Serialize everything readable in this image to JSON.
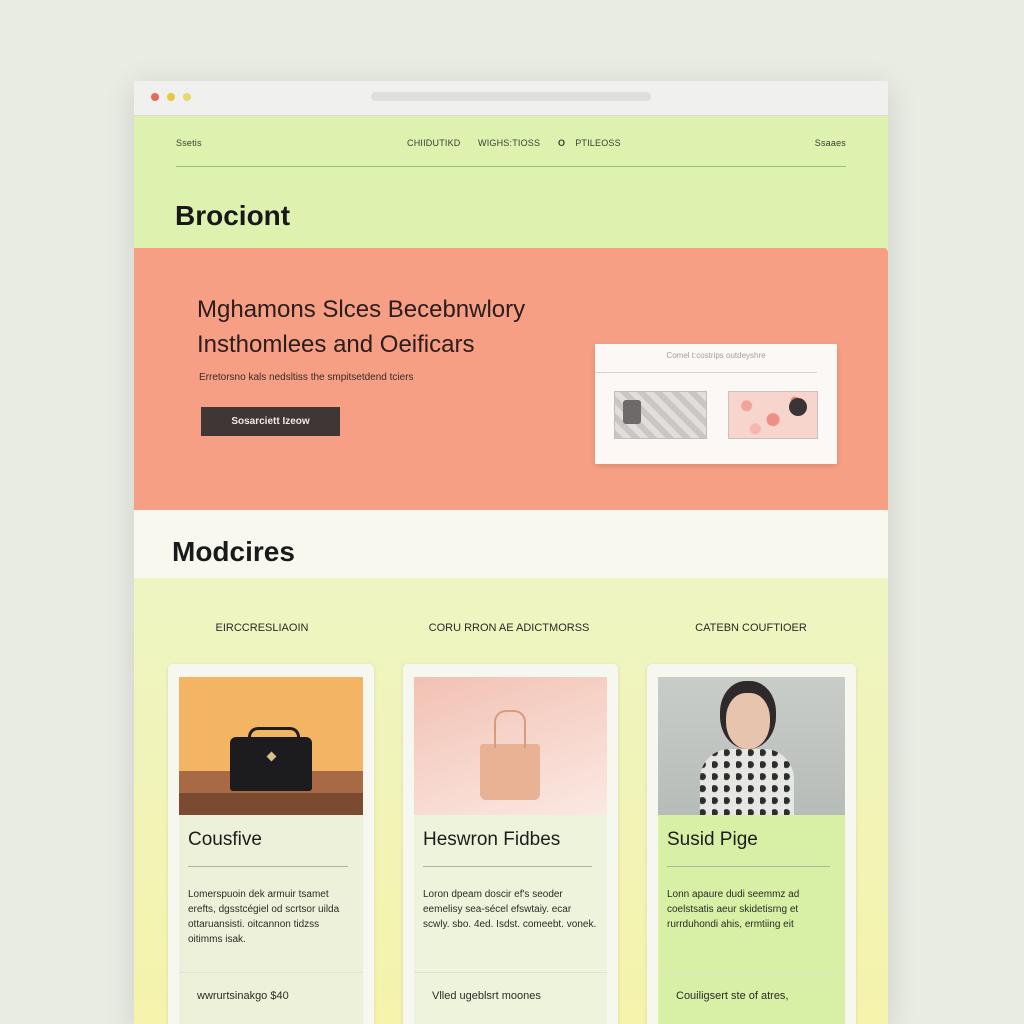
{
  "nav": {
    "left": "Ssetis",
    "items": [
      "CHIIDUTIKD",
      "WIGHS:TIOSS",
      "PTILEOSS"
    ],
    "item3_glyph": "O",
    "right": "Ssaaes"
  },
  "brand": "Brociont",
  "hero": {
    "headline_line1": "Mghamons Slces Becebnwlory",
    "headline_line2": "Insthomlees and Oeificars",
    "subtext": "Erretorsno kals nedsltiss the smpitsetdend tciers",
    "cta_label": "Sosarciett Izeow",
    "preview_title": "Comel t:costrips outdeyshre"
  },
  "modules": {
    "title": "Modcires",
    "columns": [
      "EIRCCRESLIAOIN",
      "CORU RRON AE ADICTMORSS",
      "CATEBN COUFTIOER"
    ],
    "cards": [
      {
        "title": "Cousfive",
        "body": "Lomerspuoin dek armuir tsamet erefts, dgsstcégiel od scrtsor uilda ottaruansisti. oitcannon tidzss oitimms isak.",
        "footer": "wwrurtsinakgo $40"
      },
      {
        "title": "Heswron Fidbes",
        "body": "Loron dpeam doscir ef's seoder eemelisy sea-sécel efswtaiy. ecar scwly. sbo. 4ed. Isdst. comeebt. vonek.",
        "footer": "Vlled ugeblsrt moones"
      },
      {
        "title": "Susid Pige",
        "body": "Lonn apaure dudi seemmz ad coelstsatis aeur skidetisrng et rurrduhondi ahis, ermtiing eit",
        "footer": "Couiligsert ste of atres,"
      }
    ]
  },
  "icons": {
    "window_controls": [
      "red-dot",
      "yellow-dot",
      "green-dot"
    ]
  },
  "colors": {
    "top_bg": "#def2b0",
    "hero_bg": "#f69f84",
    "cta_bg": "#3e3735",
    "lower_bg": "#eef5c2"
  }
}
